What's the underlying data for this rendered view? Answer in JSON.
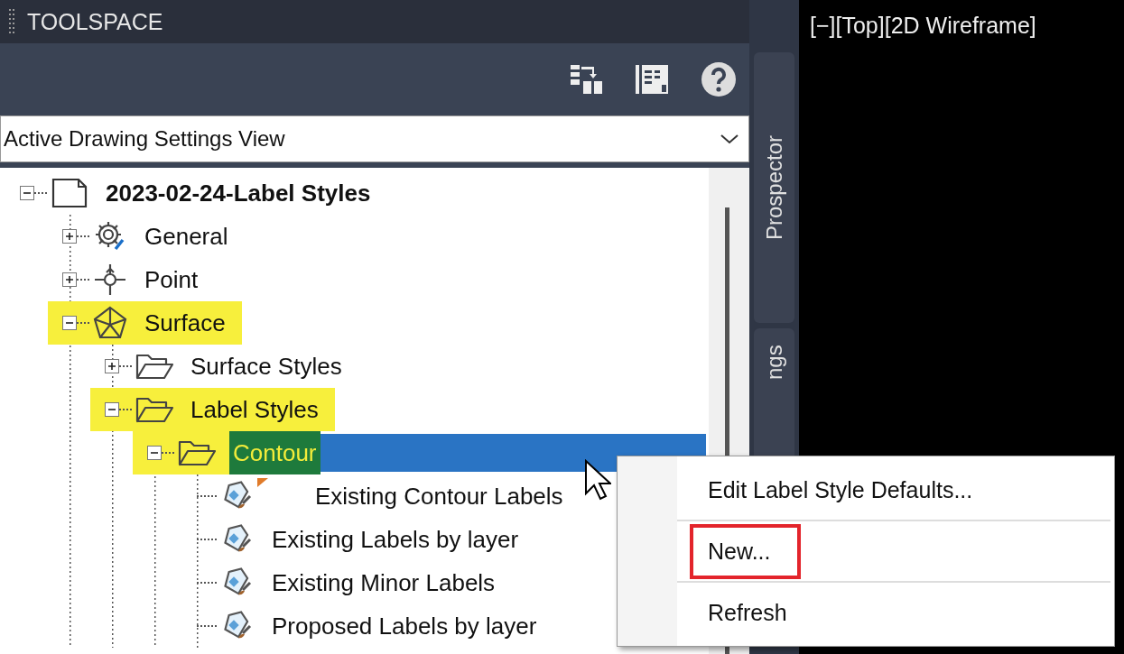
{
  "panel": {
    "title": "TOOLSPACE"
  },
  "view_dropdown": {
    "value": "Active Drawing Settings View"
  },
  "tree": [
    {
      "label": "2023-02-24-Label Styles",
      "kind": "document",
      "expanded": true,
      "selected": false,
      "highlighted": false,
      "children": [
        {
          "label": "General",
          "kind": "gear",
          "expanded": false,
          "selected": false,
          "highlighted": false
        },
        {
          "label": "Point",
          "kind": "point",
          "expanded": false,
          "selected": false,
          "highlighted": false
        },
        {
          "label": "Surface",
          "kind": "surface",
          "expanded": true,
          "selected": false,
          "highlighted": true,
          "children": [
            {
              "label": "Surface Styles",
              "kind": "folder",
              "expanded": false,
              "selected": false,
              "highlighted": false
            },
            {
              "label": "Label Styles",
              "kind": "folder",
              "expanded": true,
              "selected": false,
              "highlighted": true,
              "children": [
                {
                  "label": "Contour",
                  "kind": "folder",
                  "expanded": true,
                  "selected": true,
                  "highlighted": true,
                  "children": [
                    {
                      "label": "Existing Contour Labels",
                      "kind": "label-style",
                      "selected": false,
                      "highlighted": false,
                      "marked": true
                    },
                    {
                      "label": "Existing Labels by layer",
                      "kind": "label-style",
                      "selected": false,
                      "highlighted": false,
                      "marked": false
                    },
                    {
                      "label": "Existing Minor Labels",
                      "kind": "label-style",
                      "selected": false,
                      "highlighted": false,
                      "marked": false
                    },
                    {
                      "label": "Proposed Labels by layer",
                      "kind": "label-style",
                      "selected": false,
                      "highlighted": false,
                      "marked": false
                    }
                  ]
                }
              ]
            }
          ]
        }
      ]
    }
  ],
  "side_tabs": [
    {
      "label": "Prospector"
    },
    {
      "label": "ngs"
    }
  ],
  "viewport": {
    "label": "[−][Top][2D Wireframe]"
  },
  "context_menu": [
    {
      "label": "Edit Label Style Defaults...",
      "outlined": false
    },
    {
      "label": "New...",
      "outlined": true
    },
    {
      "label": "Refresh",
      "outlined": false
    }
  ]
}
